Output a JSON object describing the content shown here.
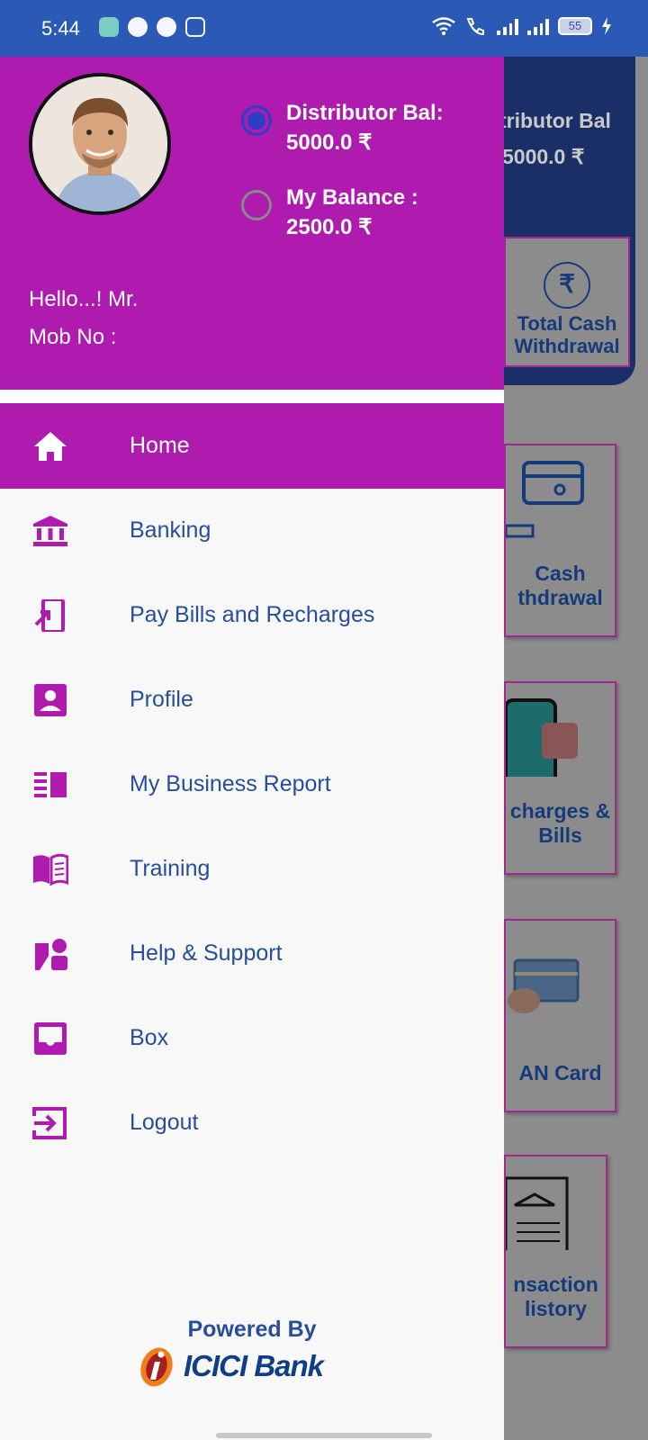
{
  "status_bar": {
    "time": "5:44",
    "battery": "55"
  },
  "background_screen": {
    "balance_label": "tributor Bal",
    "balance_value": "5000.0 ₹",
    "top_card_label": "Total Cash Withdrawal",
    "cards": [
      "Cash thdrawal",
      "charges & Bills",
      "AN Card",
      "nsaction listory"
    ]
  },
  "drawer": {
    "distributor_balance": {
      "label": "Distributor Bal:",
      "value": "5000.0 ₹"
    },
    "my_balance": {
      "label": "My Balance :",
      "value": "2500.0 ₹"
    },
    "greeting": "Hello...! Mr.",
    "mobile_label": "Mob No :",
    "menu": [
      {
        "label": "Home",
        "icon": "home-icon",
        "active": true
      },
      {
        "label": "Banking",
        "icon": "bank-icon"
      },
      {
        "label": "Pay Bills and Recharges",
        "icon": "phone-forward-icon"
      },
      {
        "label": "Profile",
        "icon": "profile-icon"
      },
      {
        "label": "My Business Report",
        "icon": "report-icon"
      },
      {
        "label": "Training",
        "icon": "book-icon"
      },
      {
        "label": "Help & Support",
        "icon": "support-icon"
      },
      {
        "label": "Box",
        "icon": "inbox-icon"
      },
      {
        "label": "Logout",
        "icon": "logout-icon"
      }
    ],
    "powered_by": "Powered By",
    "brand": "ICICI Bank"
  },
  "colors": {
    "primary": "#ae1bae",
    "text_blue": "#264e9c",
    "status_bar": "#2a5ab6",
    "radio_blue": "#2a3fc4"
  }
}
